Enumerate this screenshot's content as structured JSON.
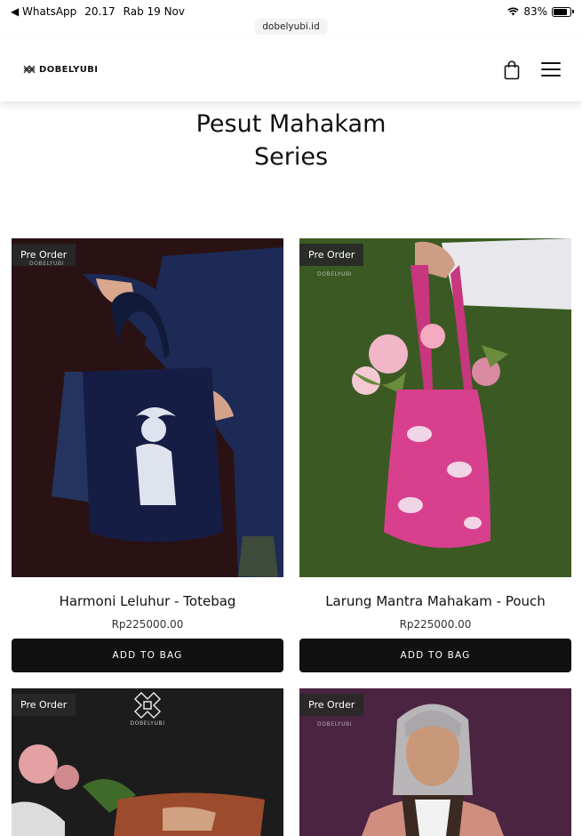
{
  "status_bar": {
    "back_app": "◀ WhatsApp",
    "time": "20.17",
    "date": "Rab 19 Nov",
    "battery": "83%",
    "battery_level": 0.83
  },
  "browser": {
    "url": "dobelyubi.id"
  },
  "header": {
    "logo_text": "DOBELYUBI"
  },
  "page": {
    "title": "Pesut Mahakam\nSeries"
  },
  "products": [
    {
      "badge": "Pre Order",
      "name": "Harmoni Leluhur - Totebag",
      "price": "Rp225000.00",
      "button": "ADD TO BAG",
      "brand": "DOBELYUBI"
    },
    {
      "badge": "Pre Order",
      "name": "Larung Mantra Mahakam - Pouch",
      "price": "Rp225000.00",
      "button": "ADD TO BAG",
      "brand": "DOBELYUBI"
    },
    {
      "badge": "Pre Order",
      "brand": "DOBELYUBI"
    },
    {
      "badge": "Pre Order",
      "brand": "DOBELYUBI"
    }
  ],
  "colors": {
    "accent": "#111111",
    "bg1": "#2a1214",
    "bg2": "#3b5a23",
    "bg3": "#1c1c1c",
    "bg4": "#4a2440"
  }
}
